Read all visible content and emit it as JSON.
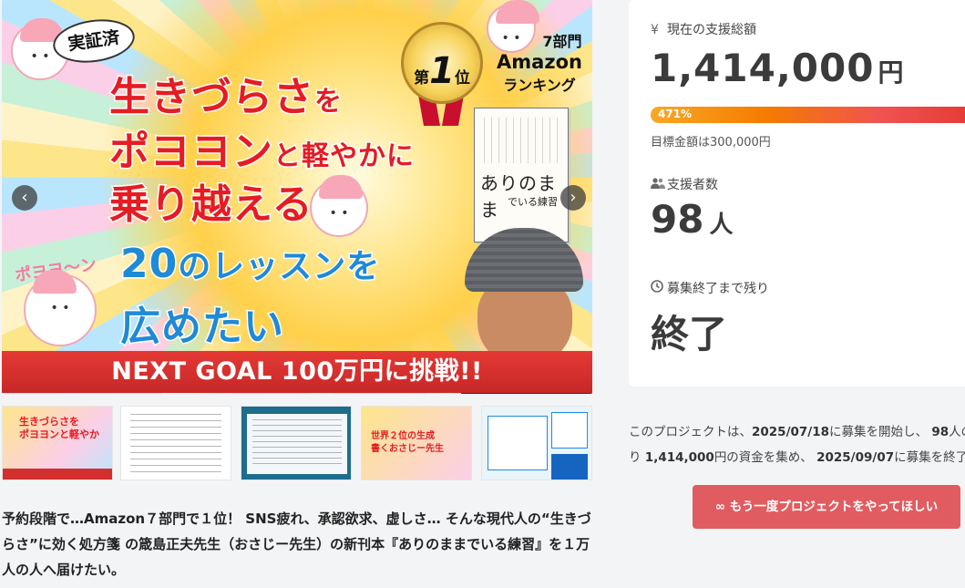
{
  "hero": {
    "badge_verified": "実証済",
    "title_line1_a": "生きづらさ",
    "title_line1_b": "を",
    "title_line2_a": "ポヨヨン",
    "title_line2_b": "と軽やかに",
    "title_line3": "乗り越える",
    "title_line4_a": "20",
    "title_line4_b": "のレッスンを",
    "title_line5": "広めたい",
    "rank_prefix": "第",
    "rank_number": "1",
    "rank_suffix": "位",
    "rank_category": "7部門",
    "rank_store": "Amazon",
    "rank_label": "ランキング",
    "book_title": "ありのまま",
    "book_subtitle": "でいる練習",
    "mascot_text": "ポヨヨ～ン",
    "goal_banner": "NEXT GOAL 100万円に挑戦!!",
    "prev_icon": "‹",
    "next_icon": "›"
  },
  "thumbnails": {
    "t1_text": "生きづらさを\nポヨヨンと軽やか",
    "t4_text": "世界２位の生成\n書くおさじー先生"
  },
  "description": "予約段階で…Amazon７部門で１位！ SNS疲れ、承認欲求、虚しさ… そんな現代人の“生きづらさ”に効く処方箋 の箴島正夫先生（おさじー先生）の新刊本『ありのままでいる練習』を１万人の人へ届けたい。",
  "stats": {
    "total_label": "現在の支援総額",
    "total_icon": "¥",
    "total_value": "1,414,000",
    "total_unit": "円",
    "progress_percent": 471,
    "progress_label": "471%",
    "goal_text": "目標金額は300,000円",
    "supporters_label": "支援者数",
    "supporters_value": "98",
    "supporters_unit": "人",
    "remaining_label": "募集終了まで残り",
    "remaining_value": "終了"
  },
  "summary": {
    "p1": "このプロジェクトは、",
    "start_date": "2025/07/18",
    "p2": "に募集を開始し、",
    "count": "98",
    "p3": "人の",
    "p4": "り",
    "amount": "1,414,000",
    "p5": "円の資金を集め、",
    "end_date": "2025/09/07",
    "p6": "に募集を終了しま"
  },
  "again_button": {
    "icon": "∞",
    "label": "もう一度プロジェクトをやってほしい"
  },
  "colors": {
    "accent": "#e15c60",
    "progress_start": "#f9a825",
    "progress_end": "#e53935",
    "title_red": "#e51c23",
    "title_blue": "#1f8ad6"
  }
}
